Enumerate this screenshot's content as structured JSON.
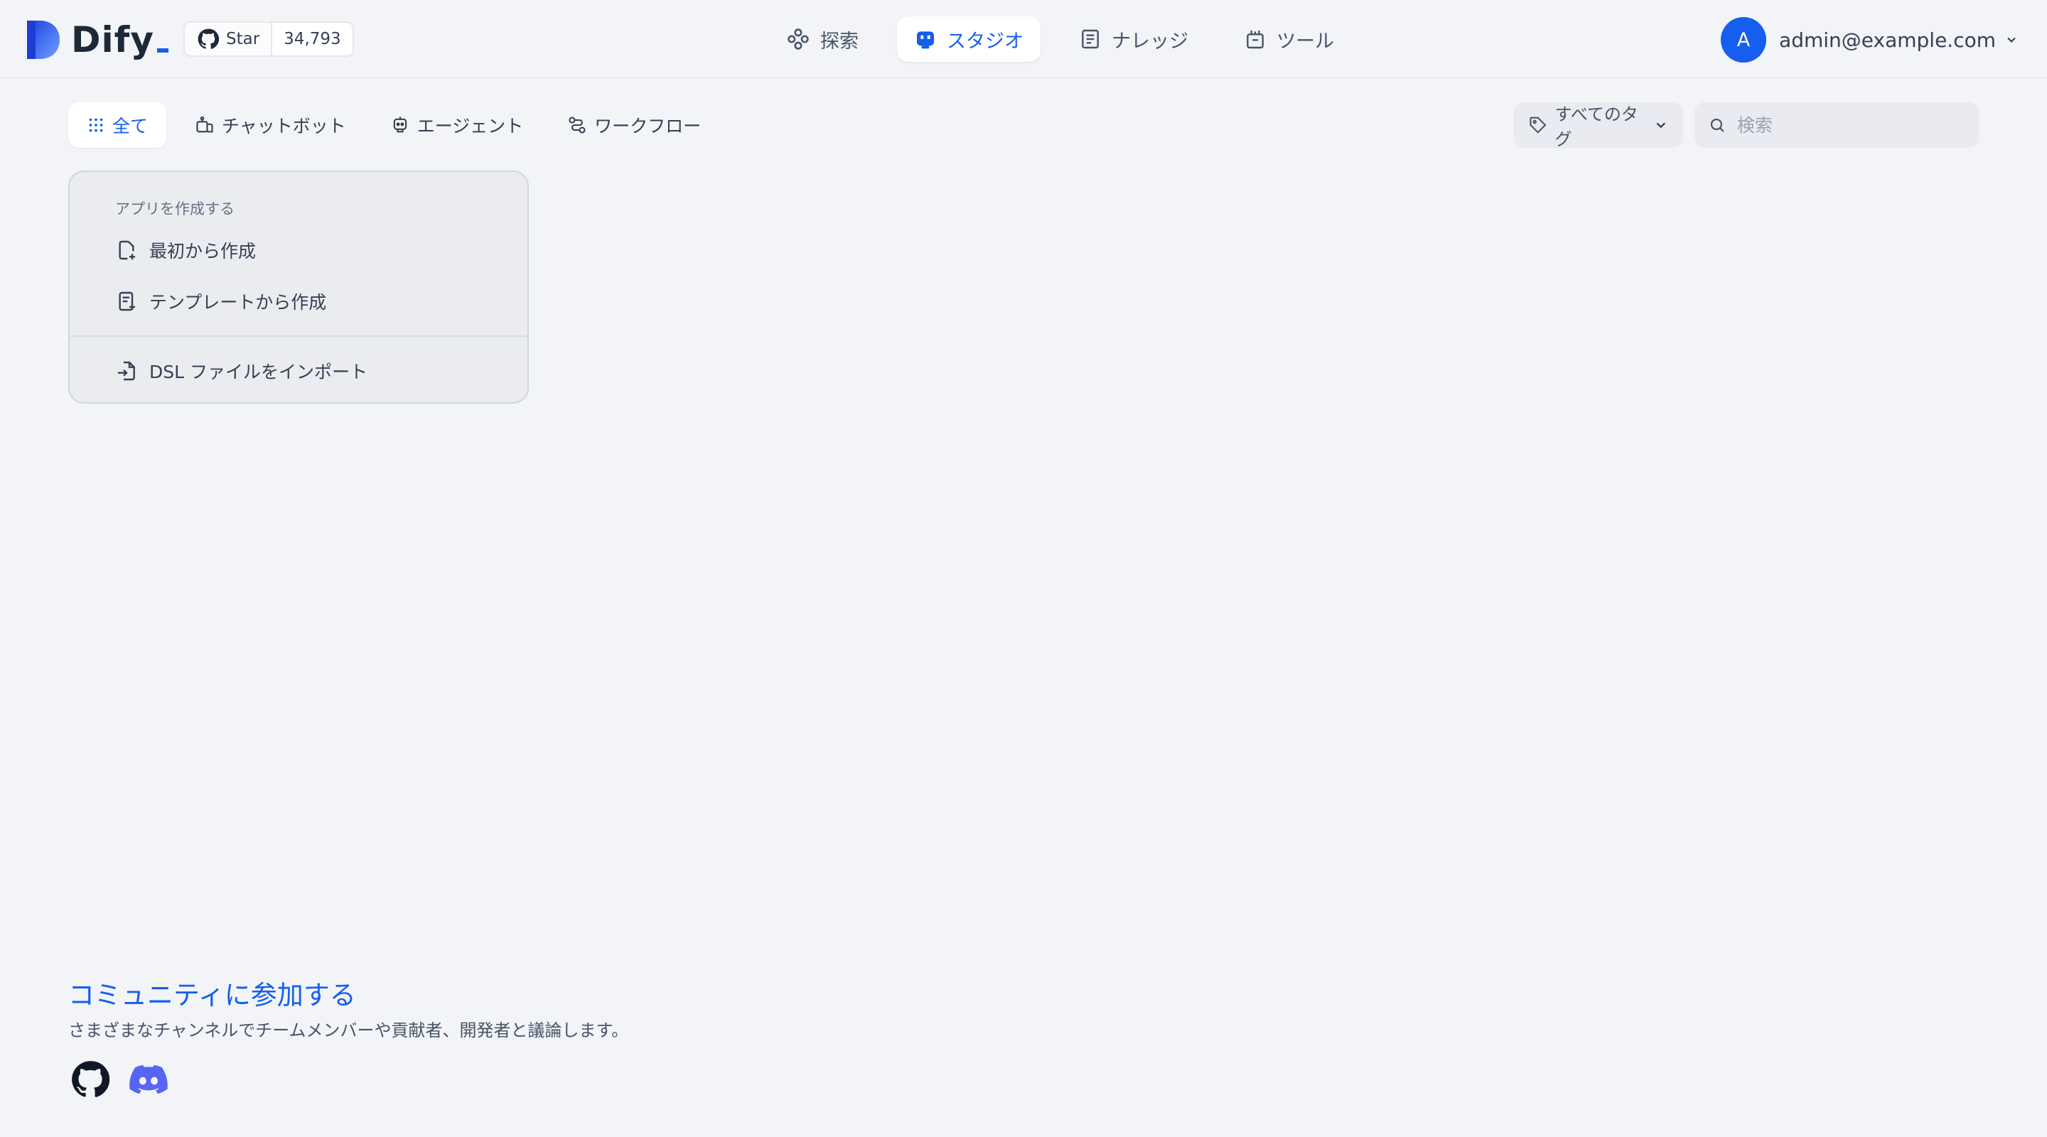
{
  "app": {
    "logo_text": "Dify",
    "github": {
      "star_label": "Star",
      "star_count": "34,793"
    }
  },
  "nav": {
    "items": [
      {
        "label": "探索",
        "icon": "explore-icon"
      },
      {
        "label": "スタジオ",
        "icon": "robot-icon",
        "active": true
      },
      {
        "label": "ナレッジ",
        "icon": "book-icon"
      },
      {
        "label": "ツール",
        "icon": "toolbox-icon"
      }
    ]
  },
  "account": {
    "avatar_letter": "A",
    "email": "admin@example.com"
  },
  "toolbar": {
    "tabs": [
      {
        "label": "全て",
        "active": true
      },
      {
        "label": "チャットボット"
      },
      {
        "label": "エージェント"
      },
      {
        "label": "ワークフロー"
      }
    ],
    "tag_filter_label": "すべてのタグ",
    "search_placeholder": "検索"
  },
  "create_card": {
    "caption": "アプリを作成する",
    "from_scratch": "最初から作成",
    "from_template": "テンプレートから作成",
    "import_dsl": "DSL ファイルをインポート"
  },
  "footer": {
    "title": "コミュニティに参加する",
    "description": "さまざまなチャンネルでチームメンバーや貢献者、開発者と議論します。"
  },
  "colors": {
    "accent": "#155eef",
    "background": "#f2f4f7",
    "discord": "#5865f2"
  }
}
